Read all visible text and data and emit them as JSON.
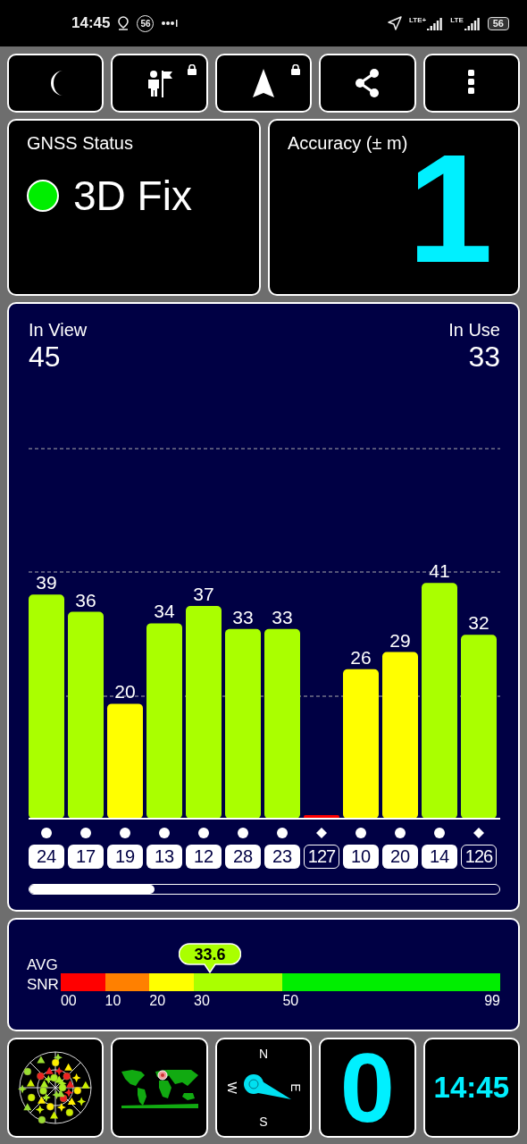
{
  "status_bar": {
    "time": "14:45",
    "badge": "56",
    "networks": [
      {
        "label": "LTE+"
      },
      {
        "label": "LTE"
      }
    ],
    "battery": "56"
  },
  "toolbar": [
    {
      "kind": "moon",
      "locked": false
    },
    {
      "kind": "person-flag",
      "locked": true
    },
    {
      "kind": "arrow",
      "locked": true
    },
    {
      "kind": "share",
      "locked": false
    },
    {
      "kind": "more",
      "locked": false
    }
  ],
  "gnss_status": {
    "title": "GNSS Status",
    "color": "#00ee00",
    "value": "3D Fix"
  },
  "accuracy": {
    "title": "Accuracy (± m)",
    "value": "1"
  },
  "satellites_panel": {
    "in_view_label": "In View",
    "in_view": "45",
    "in_use_label": "In Use",
    "in_use": "33",
    "chart_data": {
      "type": "bar",
      "categories": [
        "24",
        "17",
        "19",
        "13",
        "12",
        "28",
        "23",
        "127",
        "10",
        "20",
        "14",
        "126"
      ],
      "values": [
        39,
        36,
        20,
        34,
        37,
        33,
        33,
        0,
        26,
        29,
        41,
        32
      ],
      "value_labels": [
        "39",
        "36",
        "20",
        "34",
        "37",
        "33",
        "33",
        null,
        "26",
        "29",
        "41",
        "32"
      ]
    },
    "satellites": [
      {
        "kind": "circle",
        "used": true
      },
      {
        "kind": "circle",
        "used": true
      },
      {
        "kind": "circle",
        "used": true
      },
      {
        "kind": "circle",
        "used": true
      },
      {
        "kind": "circle",
        "used": true
      },
      {
        "kind": "circle",
        "used": true
      },
      {
        "kind": "circle",
        "used": true
      },
      {
        "kind": "diamond",
        "used": false
      },
      {
        "kind": "circle",
        "used": true
      },
      {
        "kind": "circle",
        "used": true
      },
      {
        "kind": "circle",
        "used": true
      },
      {
        "kind": "diamond",
        "used": false
      }
    ]
  },
  "snr": {
    "label_1": "AVG",
    "label_2": "SNR",
    "average": {
      "text": "33.6"
    },
    "segments": [
      {
        "color": "#ff0000"
      },
      {
        "color": "#ff8000"
      },
      {
        "color": "#ffff00"
      },
      {
        "color": "#aaff00"
      },
      {
        "color": "#00ee00"
      }
    ],
    "ticks": [
      "00",
      "10",
      "20",
      "30",
      "50",
      "99"
    ]
  },
  "tiles": [
    {
      "kind": "skyplot"
    },
    {
      "kind": "map"
    },
    {
      "kind": "compass",
      "labels": [
        "N",
        "W",
        "E",
        "S"
      ]
    },
    {
      "kind": "speed",
      "value": "0"
    },
    {
      "kind": "clock",
      "value": "14:45"
    }
  ]
}
